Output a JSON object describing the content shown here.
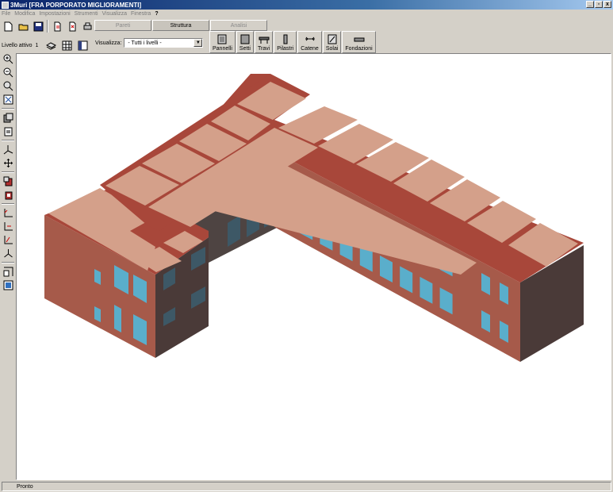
{
  "window": {
    "title": "3Muri  [FRA PORPORATO MIGLIORAMENTI]",
    "minimize": "_",
    "maximize": "▫",
    "close": "x"
  },
  "menu": [
    "File",
    "Modifica",
    "Impostazioni",
    "Strumenti",
    "Visualizza",
    "Finestra",
    "?"
  ],
  "level": {
    "label": "Livello attivo",
    "value": "1"
  },
  "tabs": [
    "Pareti",
    "Struttura",
    "Analisi"
  ],
  "visualizza": {
    "label": "Visualizza:",
    "value": "- Tutti i livelli -"
  },
  "struttura_buttons": [
    "Pannelli",
    "Setti",
    "Travi",
    "Pilastri",
    "Catene",
    "Solai",
    "Fondazioni"
  ],
  "status": {
    "text": "Pronto"
  },
  "colors": {
    "roof": "#d4a08a",
    "ridge": "#a8473a",
    "wall": "#a65a4a",
    "wall_dark": "#4a3a38",
    "window": "#5aaecb"
  }
}
